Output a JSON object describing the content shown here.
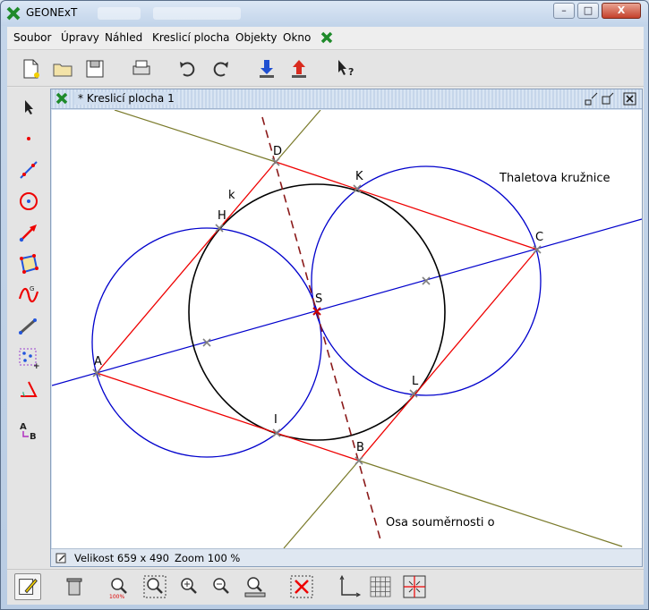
{
  "window": {
    "title": "GEONExT",
    "minimize": "–",
    "maximize": "□",
    "close": "X"
  },
  "menu": [
    "Soubor",
    "Úpravy",
    "Náhled",
    "Kreslicí plocha",
    "Objekty",
    "Okno"
  ],
  "toolbar": {
    "icons": [
      "new-file-icon",
      "open-folder-icon",
      "save-icon",
      "print-icon",
      "undo-icon",
      "redo-icon",
      "import-icon",
      "export-icon",
      "context-help-icon"
    ]
  },
  "palette": {
    "icons": [
      "pointer-icon",
      "point-icon",
      "line-icon",
      "circle-icon",
      "vector-icon",
      "polygon-icon",
      "curve-icon",
      "measure-icon",
      "group-icon",
      "angle-icon",
      "text-label-icon"
    ]
  },
  "document": {
    "title": "* Kreslicí plocha 1",
    "status_size": "Velikost 659 x 490",
    "status_zoom": "Zoom 100 %"
  },
  "drawing": {
    "points": [
      "A",
      "B",
      "C",
      "D",
      "H",
      "I",
      "K",
      "L",
      "S"
    ],
    "circle_label": "k",
    "text_thales": "Thaletova kružnice",
    "text_axis": "Osa souměrnosti o",
    "colors": {
      "circle_black": "#000000",
      "circles_blue": "#0000cc",
      "segments_red": "#ee0000",
      "lines_olive": "#7a7a2a",
      "axis_dashed": "#8b1a1a",
      "point_gray": "#7f7f7f",
      "center_red": "#cc0000"
    }
  },
  "bottombar": {
    "icons": [
      "edit-mode-icon",
      "trash-icon",
      "zoom-100-icon",
      "zoom-fit-icon",
      "zoom-in-icon",
      "zoom-out-icon",
      "zoom-restore-icon",
      "delete-selection-icon",
      "axes-icon",
      "grid-icon",
      "center-view-icon"
    ]
  }
}
